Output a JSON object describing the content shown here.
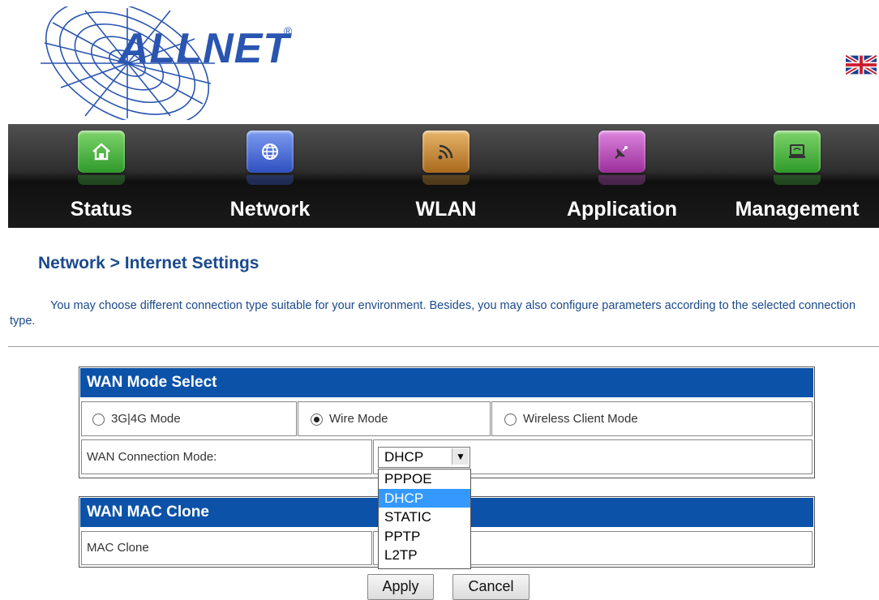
{
  "brand": {
    "name": "ALLNET",
    "registered": "®"
  },
  "language_flag": "uk-flag-icon",
  "nav": {
    "items": [
      {
        "label": "Status",
        "icon": "home-icon",
        "color": "#3fae3a"
      },
      {
        "label": "Network",
        "icon": "globe-icon",
        "color": "#3b5fd0"
      },
      {
        "label": "WLAN",
        "icon": "rss-wifi-icon",
        "color": "#c98a2e"
      },
      {
        "label": "Application",
        "icon": "satellite-icon",
        "color": "#b84ab8"
      },
      {
        "label": "Management",
        "icon": "laptop-icon",
        "color": "#3fae3a"
      }
    ]
  },
  "breadcrumb": "Network > Internet Settings",
  "description": "You may choose different connection type suitable for your environment. Besides, you may also configure parameters according to the selected connection type.",
  "wan_mode": {
    "title": "WAN Mode Select",
    "options": [
      {
        "label": "3G|4G Mode",
        "selected": false
      },
      {
        "label": "Wire Mode",
        "selected": true
      },
      {
        "label": "Wireless Client Mode",
        "selected": false
      }
    ],
    "connection_label": "WAN Connection Mode:",
    "connection_value": "DHCP",
    "dropdown_options": [
      "PPPOE",
      "DHCP",
      "STATIC",
      "PPTP",
      "L2TP"
    ],
    "dropdown_selected": "DHCP"
  },
  "mac_clone": {
    "title": "WAN MAC Clone",
    "row_label": "MAC Clone"
  },
  "buttons": {
    "apply": "Apply",
    "cancel": "Cancel"
  },
  "colors": {
    "header_blue": "#0b52a8",
    "text_blue": "#1a4a8c",
    "highlight": "#3399ff"
  }
}
